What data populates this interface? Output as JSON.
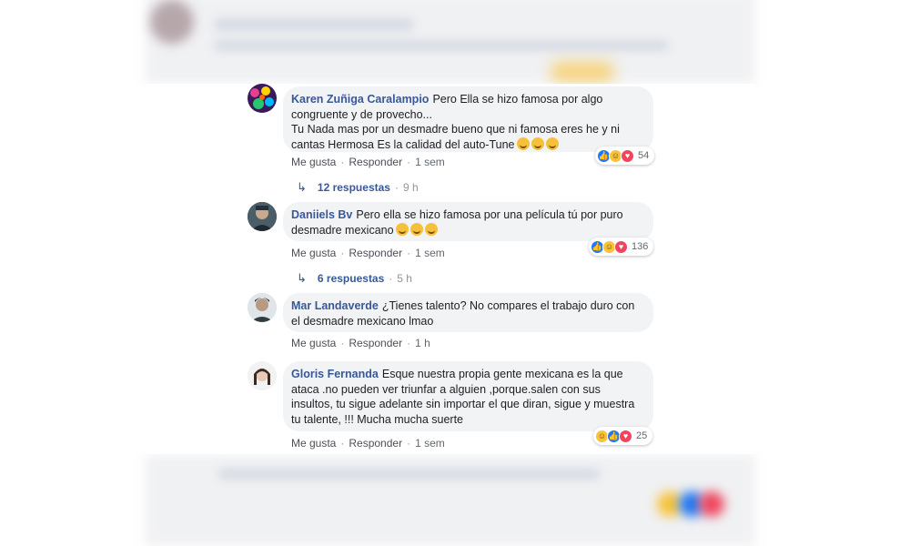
{
  "comments": [
    {
      "author": "Karen Zuñiga Caralampio",
      "text": "Pero Ella se hizo famosa por algo congruente y de provecho...\nTu Nada mas por un desmadre bueno que ni famosa eres he y ni cantas Hermosa Es la calidad del auto-Tune",
      "emoji": "smiling-face x3",
      "reaction_count": "54",
      "like_label": "Me gusta",
      "reply_label": "Responder",
      "time": "1 sem",
      "replies_label": "12 respuestas",
      "replies_time": "9 h"
    },
    {
      "author": "Daniiels Bv",
      "text": "Pero ella se hizo famosa por una película tú por puro desmadre mexicano",
      "emoji": "rolling-laughing x3",
      "reaction_count": "136",
      "like_label": "Me gusta",
      "reply_label": "Responder",
      "time": "1 sem",
      "replies_label": "6 respuestas",
      "replies_time": "5 h"
    },
    {
      "author": "Mar Landaverde",
      "text": "¿Tienes talento? No compares el trabajo duro con el desmadre mexicano lmao",
      "like_label": "Me gusta",
      "reply_label": "Responder",
      "time": "1 h"
    },
    {
      "author": "Gloris Fernanda",
      "text": "Esque nuestra propia gente mexicana es la que ataca .no pueden ver triunfar a alguien ,porque.salen con sus insultos, tu sigue adelante sin importar el que diran, sigue y muestra tu talente, !!! Mucha mucha suerte",
      "reaction_count": "25",
      "like_label": "Me gusta",
      "reply_label": "Responder",
      "time": "1 sem"
    }
  ],
  "colors": {
    "author": "#385898",
    "bubble": "#f2f3f5",
    "like": "#2078f4",
    "love": "#f0455e",
    "haha": "#f7c33b"
  }
}
